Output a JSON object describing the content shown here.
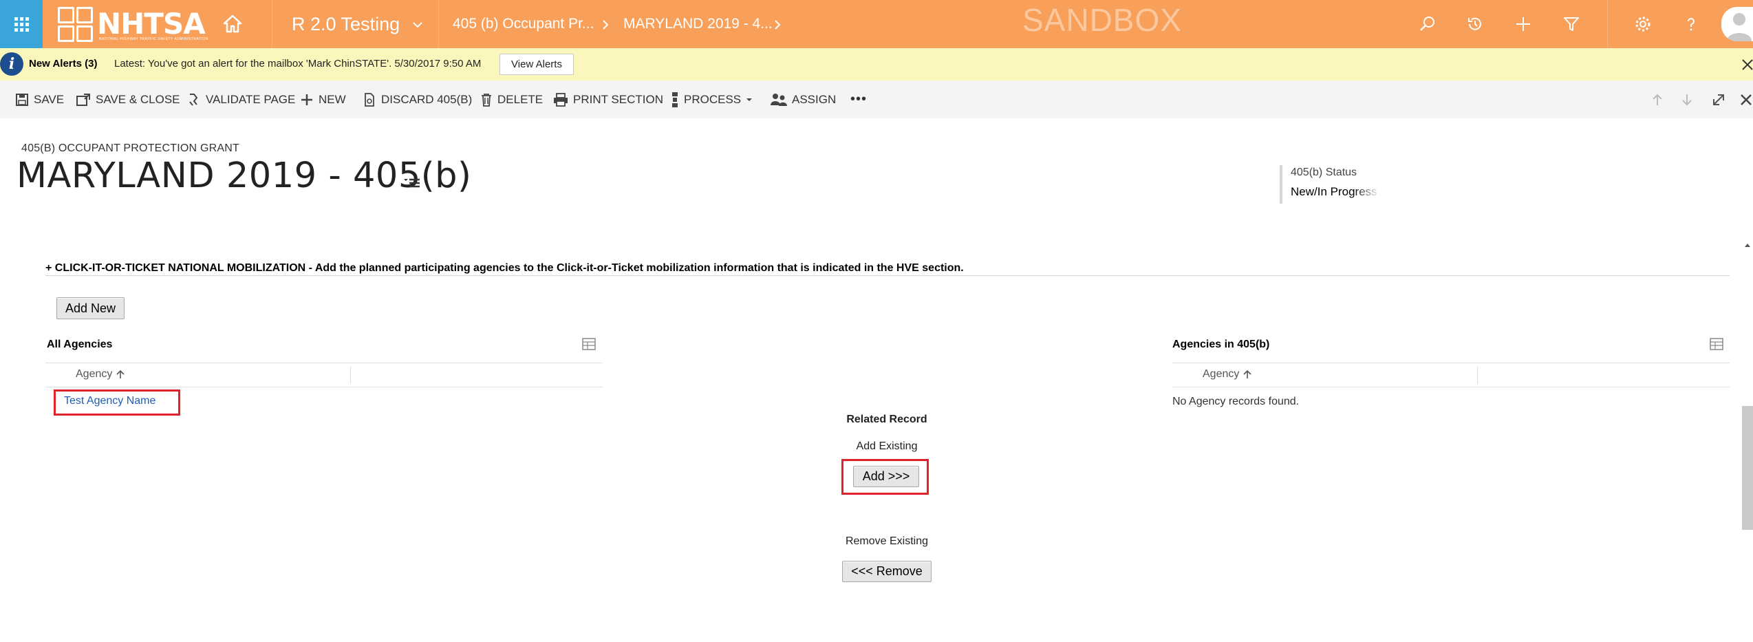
{
  "topbar": {
    "logo_text": "NHTSA",
    "logo_subtext": "NATIONAL HIGHWAY TRAFFIC SAFETY ADMINISTRATION",
    "area_title": "R 2.0 Testing",
    "breadcrumb_1": "405 (b) Occupant Pr...",
    "breadcrumb_2": "MARYLAND 2019 - 4...",
    "environment": "SANDBOX",
    "bar_color": "#f8a05a",
    "launcher_color": "#3aa5d8",
    "icons": [
      "search-icon",
      "recent-icon",
      "create-icon",
      "advanced-find-icon",
      "settings-icon",
      "help-icon",
      "user-avatar-icon"
    ]
  },
  "alert": {
    "title": "New Alerts (3)",
    "message": "Latest: You've got an alert for the mailbox 'Mark ChinSTATE'. 5/30/2017 9:50 AM",
    "button": "View Alerts",
    "background": "#fbf6bb"
  },
  "commands": {
    "save": "SAVE",
    "save_close": "SAVE & CLOSE",
    "validate": "VALIDATE PAGE",
    "new": "NEW",
    "discard": "DISCARD 405(B)",
    "delete": "DELETE",
    "print": "PRINT SECTION",
    "process": "PROCESS",
    "assign": "ASSIGN",
    "more": "•••"
  },
  "header": {
    "entity_name": "405(B) OCCUPANT PROTECTION GRANT",
    "record_title": "MARYLAND 2019 - 405(b)",
    "status_label": "405(b) Status",
    "status_value": "New/In Progress"
  },
  "section": {
    "title": "+ CLICK-IT-OR-TICKET NATIONAL MOBILIZATION - Add the planned participating agencies to the Click-it-or-Ticket mobilization information that is indicated in the HVE section.",
    "add_new": "Add New"
  },
  "all_agencies": {
    "title": "All Agencies",
    "column": "Agency",
    "rows": [
      "Test Agency Name"
    ]
  },
  "related": {
    "heading": "Related Record",
    "add_label": "Add Existing",
    "add_button": "Add >>>",
    "remove_label": "Remove Existing",
    "remove_button": "<<< Remove"
  },
  "agencies_405b": {
    "title": "Agencies in 405(b)",
    "column": "Agency",
    "empty": "No Agency records found."
  },
  "highlight_color": "#e0222b"
}
